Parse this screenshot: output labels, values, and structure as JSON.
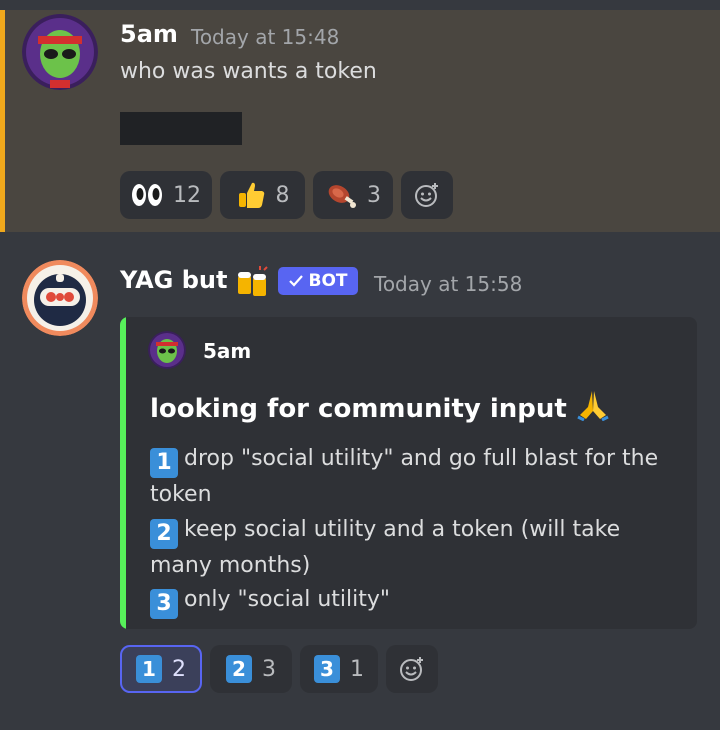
{
  "message1": {
    "author": "5am",
    "timestamp": "Today at 15:48",
    "text": "who was wants a token",
    "reactions": [
      {
        "emoji": "eyes-icon",
        "count": "12"
      },
      {
        "emoji": "thumbs-up-icon",
        "count": "8"
      },
      {
        "emoji": "meat-on-bone-icon",
        "count": "3"
      }
    ]
  },
  "message2": {
    "author": "YAG but",
    "badge": "BOT",
    "timestamp": "Today at 15:58",
    "embed": {
      "author": "5am",
      "title": "looking for community input",
      "options": [
        {
          "key": "1",
          "text": "drop \"social utility\" and go full blast for the token"
        },
        {
          "key": "2",
          "text": "keep social utility and a token (will take many months)"
        },
        {
          "key": "3",
          "text": "only \"social utility\""
        }
      ]
    },
    "reactions": [
      {
        "key": "1",
        "count": "2"
      },
      {
        "key": "2",
        "count": "3"
      },
      {
        "key": "3",
        "count": "1"
      }
    ]
  },
  "colors": {
    "accent_bar": "#f0a81c",
    "embed_bar": "#57f05a",
    "bot_badge": "#5865f2",
    "keycap": "#3a8fd9"
  }
}
